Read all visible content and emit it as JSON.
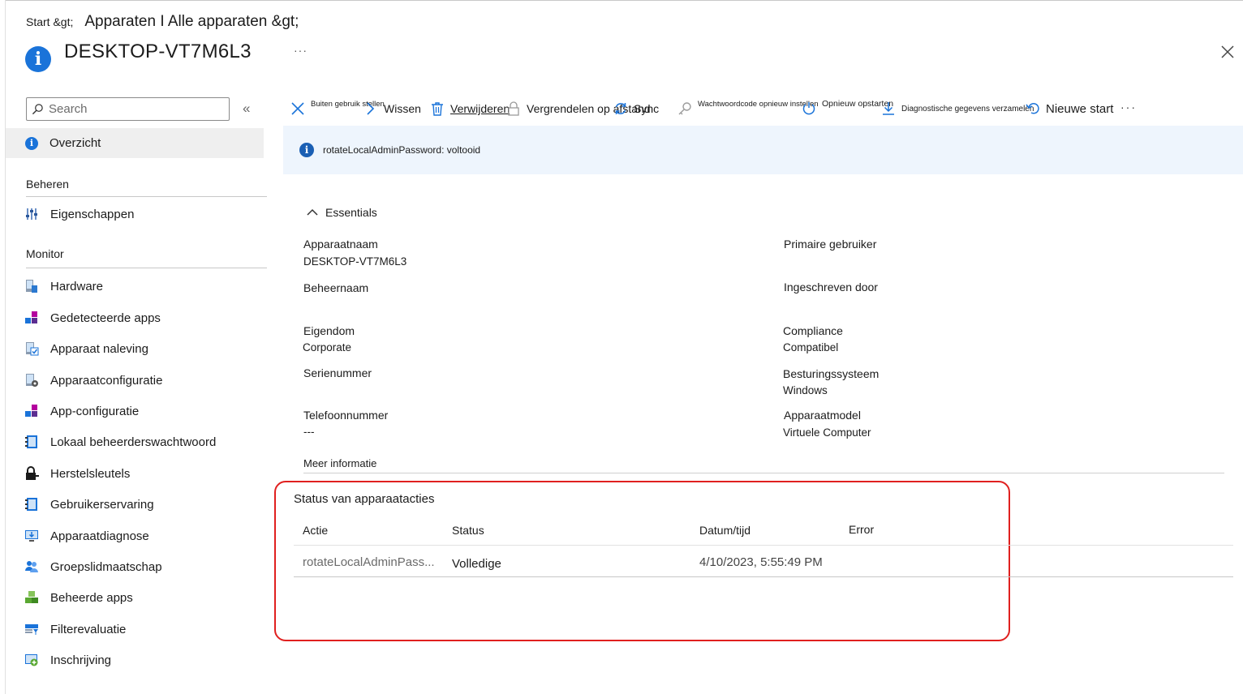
{
  "header": {
    "breadcrumb_start": "Start &gt;",
    "breadcrumb_devices": "Apparaten I Alle apparaten &gt;",
    "title": "DESKTOP-VT7M6L3",
    "more": "···"
  },
  "sidebar": {
    "search_placeholder": "Search",
    "collapse": "«",
    "overview": "Overzicht",
    "sections": [
      {
        "label": "Beheren",
        "items": [
          {
            "label": "Eigenschappen",
            "icon": "properties-icon"
          }
        ]
      },
      {
        "label": "Monitor",
        "items": [
          {
            "label": "Hardware",
            "icon": "hardware-icon"
          },
          {
            "label": "Gedetecteerde apps",
            "icon": "apps-icon"
          },
          {
            "label": "Apparaat naleving",
            "icon": "compliance-icon"
          },
          {
            "label": "Apparaatconfiguratie",
            "icon": "configuration-icon"
          },
          {
            "label": "App-configuratie",
            "icon": "app-config-icon"
          },
          {
            "label": "Lokaal beheerderswachtwoord",
            "icon": "notebook-icon"
          },
          {
            "label": "Herstelsleutels",
            "icon": "lock-key-icon"
          },
          {
            "label": "Gebruikerservaring",
            "icon": "notebook-icon"
          },
          {
            "label": "Apparaatdiagnose",
            "icon": "diagnostics-icon"
          },
          {
            "label": "Groepslidmaatschap",
            "icon": "group-icon"
          },
          {
            "label": "Beheerde apps",
            "icon": "cubes-icon"
          },
          {
            "label": "Filterevaluatie",
            "icon": "filter-icon"
          },
          {
            "label": "Inschrijving",
            "icon": "enrollment-icon"
          }
        ]
      }
    ]
  },
  "toolbar": {
    "retire": "Buiten gebruik stellen",
    "wipe": "Wissen",
    "delete": "Verwijderen",
    "remote_lock": "Vergrendelen op afstand",
    "sync": "Sync",
    "reset_passcode": "Wachtwoordcode opnieuw instellen",
    "restart": "Opnieuw opstarten",
    "diagnostics": "Diagnostische gegevens verzamelen",
    "fresh_start": "Nieuwe start",
    "more": "···"
  },
  "notification": {
    "text": "rotateLocalAdminPassword: voltooid"
  },
  "essentials": {
    "heading": "Essentials",
    "left": [
      {
        "label": "Apparaatnaam",
        "value": "DESKTOP-VT7M6L3"
      },
      {
        "label": "Beheernaam",
        "value": ""
      },
      {
        "label": "Eigendom",
        "value": "Corporate"
      },
      {
        "label": "Serienummer",
        "value": ""
      },
      {
        "label": "Telefoonnummer",
        "value": "---"
      }
    ],
    "right": [
      {
        "label": "Primaire gebruiker",
        "value": ""
      },
      {
        "label": "Ingeschreven door",
        "value": ""
      },
      {
        "label": "Compliance",
        "value": "Compatibel"
      },
      {
        "label": "Besturingssysteem",
        "value": "Windows"
      },
      {
        "label": "Apparaatmodel",
        "value": "Virtuele Computer"
      }
    ],
    "more_info": "Meer informatie"
  },
  "action_status": {
    "title": "Status van apparaatacties",
    "columns": [
      "Actie",
      "Status",
      "Datum/tijd",
      "Error"
    ],
    "rows": [
      {
        "action": "rotateLocalAdminPass...",
        "status": "Volledige",
        "datetime": "4/10/2023, 5:55:49 PM",
        "error": ""
      }
    ]
  },
  "colors": {
    "accent": "#1a73d9",
    "notice_bg": "#eef5fd",
    "highlight_border": "#e0201f",
    "nav_selected_bg": "#efefef"
  }
}
